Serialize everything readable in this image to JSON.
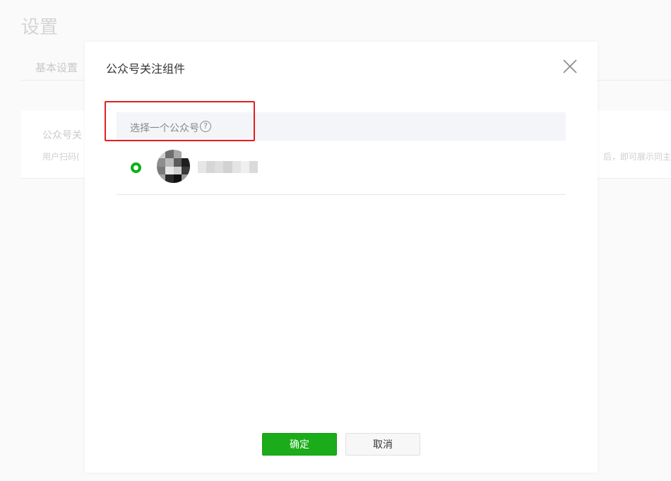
{
  "background": {
    "page_title": "设置",
    "tab_basic": "基本设置",
    "card_title": "公众号关",
    "card_desc_left": "用户扫码(",
    "card_desc_right": "后，即可展示同主"
  },
  "modal": {
    "title": "公众号关注组件",
    "section_label": "选择一个公众号",
    "help_icon_glyph": "?",
    "ok_button": "确定",
    "cancel_button": "取消"
  },
  "colors": {
    "accent_green": "#1aad19",
    "highlight_red": "#e02020"
  }
}
